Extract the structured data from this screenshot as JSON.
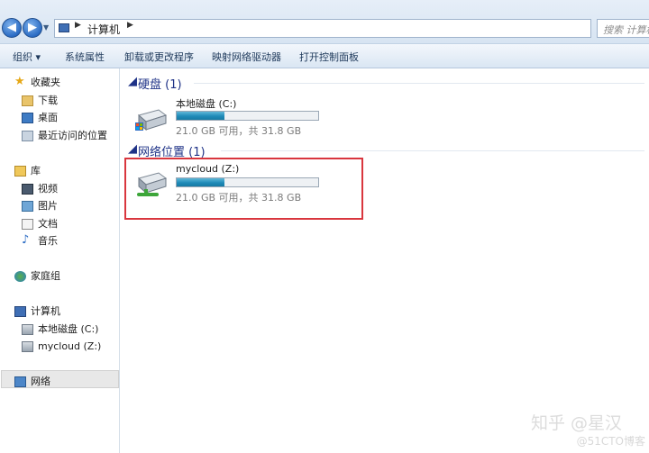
{
  "address": {
    "crumb": "计算机",
    "search_placeholder": "搜索 计算机"
  },
  "toolbar": {
    "organize": "组织 ▾",
    "system_properties": "系统属性",
    "uninstall": "卸载或更改程序",
    "map_drive": "映射网络驱动器",
    "control_panel": "打开控制面板"
  },
  "sidebar": {
    "favorites": "收藏夹",
    "downloads": "下载",
    "desktop": "桌面",
    "recent": "最近访问的位置",
    "libraries": "库",
    "videos": "视频",
    "pictures": "图片",
    "documents": "文档",
    "music": "音乐",
    "homegroup": "家庭组",
    "computer": "计算机",
    "local_disk": "本地磁盘 (C:)",
    "mycloud": "mycloud (Z:)",
    "network": "网络"
  },
  "main": {
    "hard_disks_header": "硬盘 (1)",
    "network_header": "网络位置 (1)",
    "drives": [
      {
        "name": "本地磁盘 (C:)",
        "info": "21.0 GB 可用，共 31.8 GB",
        "used_fraction": 0.34
      },
      {
        "name": "mycloud (Z:)",
        "info": "21.0 GB 可用，共 31.8 GB",
        "used_fraction": 0.34
      }
    ]
  },
  "watermark": {
    "main": "知乎 @星汉",
    "sub": "@51CTO博客"
  },
  "colors": {
    "accent": "#1e3287",
    "highlight_box": "#d9363e",
    "drive_fill": "#1f8bb8"
  }
}
